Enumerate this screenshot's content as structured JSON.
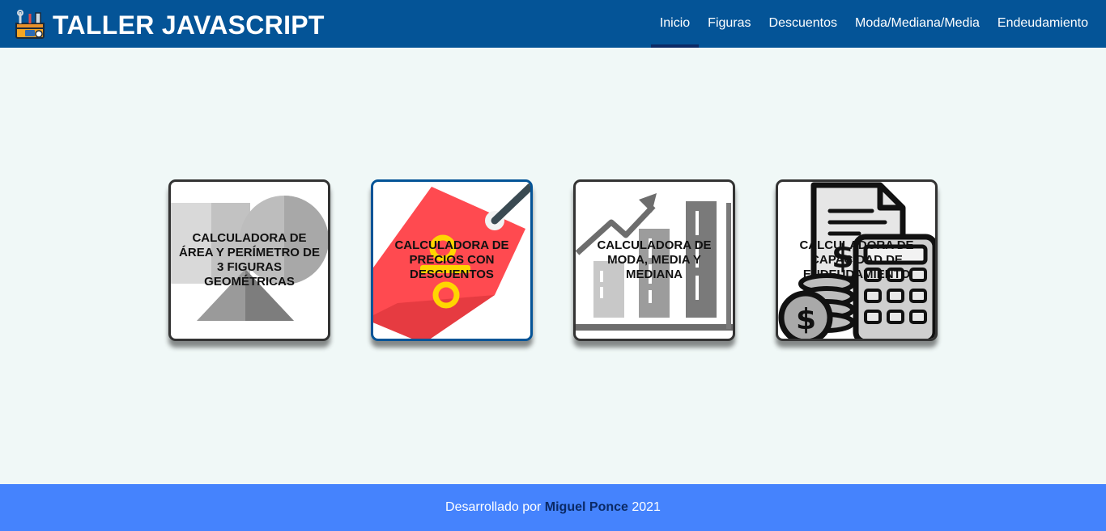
{
  "brand": {
    "title": "TALLER JAVASCRIPT",
    "logo_icon": "toolbox-icon"
  },
  "nav": {
    "items": [
      {
        "label": "Inicio",
        "active": true
      },
      {
        "label": "Figuras"
      },
      {
        "label": "Descuentos"
      },
      {
        "label": "Moda/Mediana/Media"
      },
      {
        "label": "Endeudamiento"
      }
    ]
  },
  "cards": [
    {
      "label": "CALCULADORA DE ÁREA Y PERÍMETRO DE 3 FIGURAS GEOMÉTRICAS",
      "icon": "geometric-shapes-icon"
    },
    {
      "label": "CALCULADORA DE PRECIOS CON DESCUENTOS",
      "icon": "discount-tag-icon"
    },
    {
      "label": "CALCULADORA DE MODA, MEDIA Y MEDIANA",
      "icon": "bar-chart-growth-icon"
    },
    {
      "label": "CALCULADORA DE CAPACIDAD DE ENDEUDAMIENTO",
      "icon": "calculator-coins-icon"
    }
  ],
  "footer": {
    "prefix": "Desarrollado por",
    "author": "Miguel Ponce",
    "year": "2021"
  },
  "colors": {
    "navbar": "#045497",
    "footer": "#4583fd",
    "background": "#f0f8f7",
    "accent_dark": "#0b2a66"
  }
}
